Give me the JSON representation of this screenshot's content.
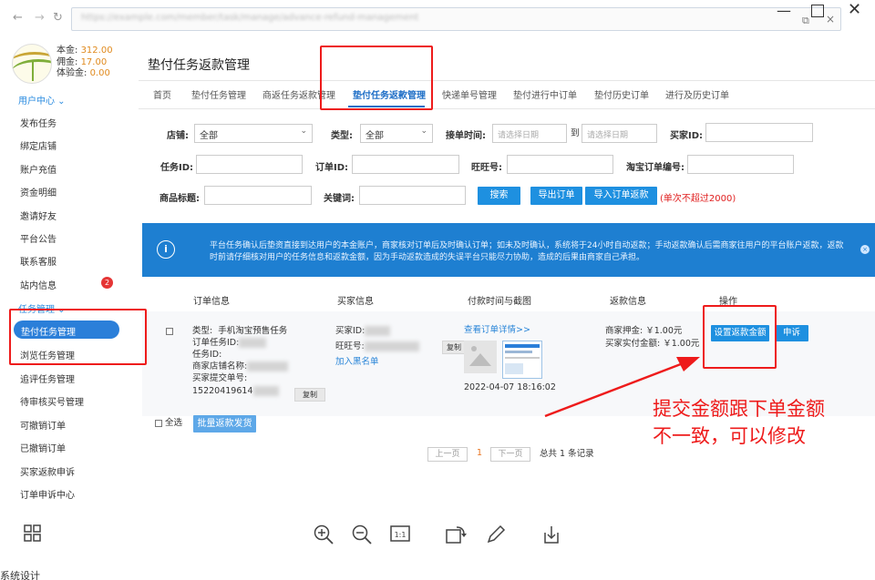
{
  "browser": {
    "url": "https://example.com/member/task/manage/advance-refund-management",
    "close_tab": "×"
  },
  "sidebar": {
    "balances": {
      "principal_label": "本金:",
      "principal_value": "312.00",
      "commission_label": "佣金:",
      "commission_value": "17.00",
      "trial_label": "体验金:",
      "trial_value": "0.00"
    },
    "user_center": "用户中心",
    "items": [
      "发布任务",
      "绑定店铺",
      "账户充值",
      "资金明细",
      "邀请好友",
      "平台公告",
      "联系客服",
      "站内信息"
    ],
    "message_badge": "2",
    "task_group": "任务管理",
    "active_item": "垫付任务管理",
    "task_items": [
      "浏览任务管理",
      "追评任务管理",
      "待审核买号管理",
      "可撤销订单",
      "已撤销订单",
      "买家返款申诉",
      "订单申诉中心"
    ]
  },
  "header": {
    "title": "垫付任务返款管理"
  },
  "tabs": [
    "首页",
    "垫付任务管理",
    "商返任务返款管理",
    "垫付任务返款管理",
    "快递单号管理",
    "垫付进行中订单",
    "垫付历史订单",
    "进行及历史订单"
  ],
  "filters": {
    "shop_label": "店铺:",
    "shop_value": "全部",
    "type_label": "类型:",
    "type_value": "全部",
    "order_time_label": "接单时间:",
    "date_placeholder": "请选择日期",
    "to_label": "到",
    "buyer_id_label": "买家ID:",
    "task_id_label": "任务ID:",
    "order_id_label": "订单ID:",
    "wangwang_label": "旺旺号:",
    "taobao_order_label": "淘宝订单编号:",
    "product_title_label": "商品标题:",
    "keyword_label": "关键词:",
    "search_button": "搜索",
    "export_button": "导出订单",
    "import_button": "导入订单返款",
    "limit_note": "(单次不超过2000)"
  },
  "notice": {
    "text": "平台任务确认后垫资直接到达用户的本金账户，商家核对订单后及时确认订单；如未及时确认，系统将于24小时自动返款；手动返款确认后需商家往用户的平台账户返款，返款时前请仔细核对用户的任务信息和返款金额，因为手动返款造成的失误平台只能尽力协助，造成的后果由商家自己承担。"
  },
  "table": {
    "headers": [
      "订单信息",
      "买家信息",
      "付款时间与截图",
      "返款信息",
      "操作"
    ],
    "row": {
      "type_label": "类型:",
      "type_value": "手机淘宝预售任务",
      "order_no_label": "订单任务ID:",
      "task_id_label": "任务ID:",
      "shop_name_label": "商家店铺名称:",
      "submit_no_label": "买家提交单号:",
      "submit_no_value": "15220419614",
      "copy_label": "复制",
      "buyer_id_label": "买家ID:",
      "wangwang_label": "旺旺号:",
      "blacklist_link": "加入黑名单",
      "view_order_link": "查看订单详情>>",
      "pay_time": "2022-04-07 18:16:02",
      "deposit_label": "商家押金:",
      "deposit_value": "￥1.00元",
      "actual_pay_label": "买家实付金额:",
      "actual_pay_value": "￥1.00元",
      "set_refund_button": "设置返款金额",
      "appeal_button": "申诉"
    },
    "select_all": "全选",
    "batch_refund_button": "批量返款发货"
  },
  "pagination": {
    "prev": "上一页",
    "current": "1",
    "next": "下一页",
    "summary": "总共 1 条记录"
  },
  "annotation": {
    "line1": "提交金额跟下单金额",
    "line2": "不一致，可以修改"
  },
  "bottom_text": "系统设计"
}
